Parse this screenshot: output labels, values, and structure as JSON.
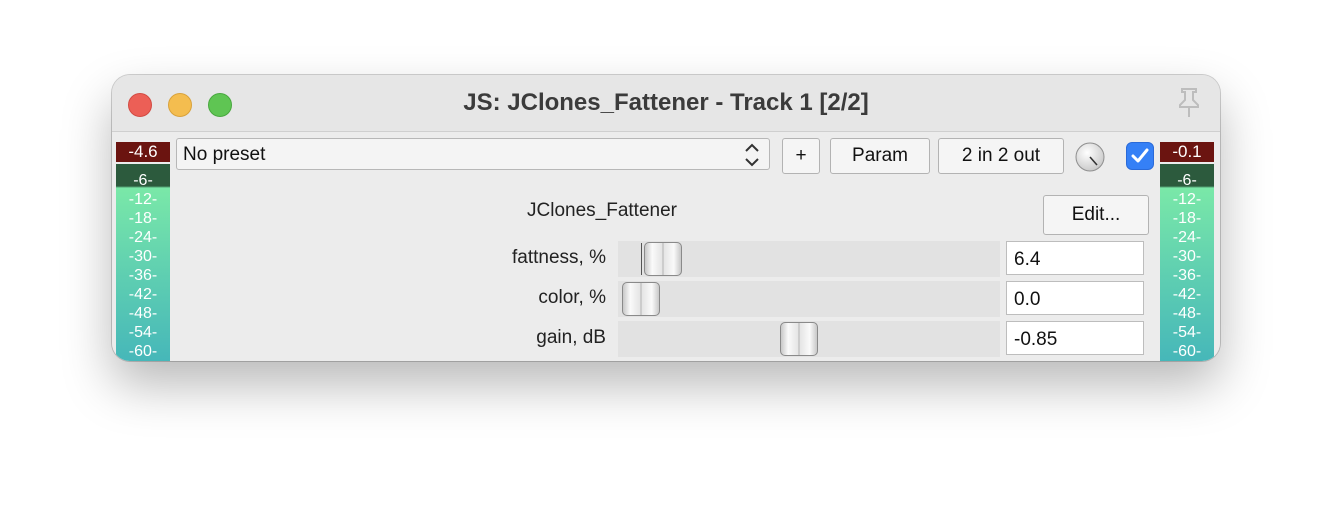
{
  "window": {
    "title": "JS: JClones_Fattener - Track 1 [2/2]"
  },
  "toolbar": {
    "preset": "No preset",
    "add_label": "+",
    "param_label": "Param",
    "io_label": "2 in 2 out",
    "bypass_checked": true
  },
  "meters": {
    "left_peak": "-4.6",
    "right_peak": "-0.1",
    "ticks": [
      "-6-",
      "-12-",
      "-18-",
      "-24-",
      "-30-",
      "-36-",
      "-42-",
      "-48-",
      "-54-",
      "-60-"
    ]
  },
  "plugin": {
    "name": "JClones_Fattener",
    "edit_label": "Edit...",
    "params": [
      {
        "label": "fattness, %",
        "value": "6.4",
        "position": 0.064
      },
      {
        "label": "color, %",
        "value": "0.0",
        "position": 0.0
      },
      {
        "label": "gain, dB",
        "value": "-0.85",
        "position": 0.47
      }
    ]
  },
  "colors": {
    "accent": "#3580f6",
    "meter_peak": "#6b1410",
    "meter_green": "#7ae8a8"
  }
}
